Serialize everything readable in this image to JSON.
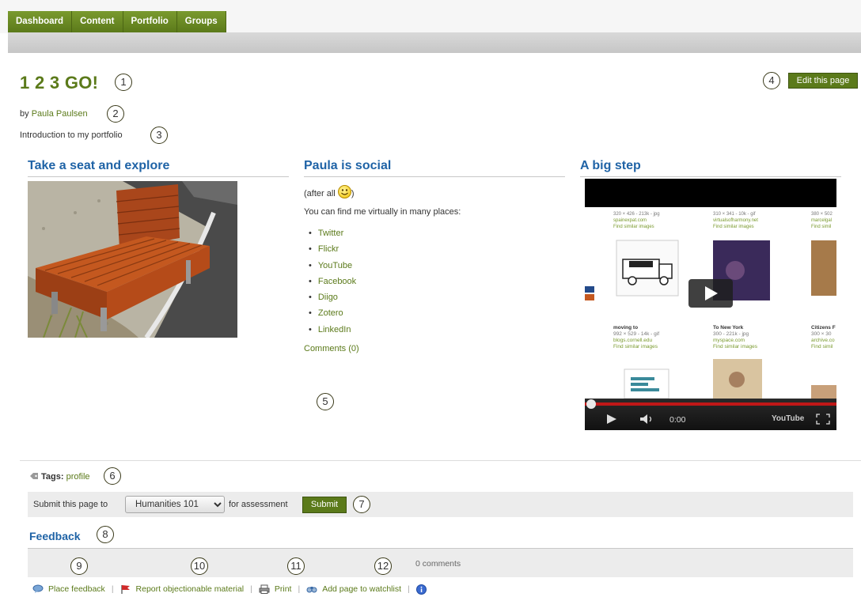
{
  "nav": {
    "tabs": [
      "Dashboard",
      "Content",
      "Portfolio",
      "Groups"
    ]
  },
  "page": {
    "title": "1 2 3 GO!",
    "by_prefix": "by",
    "author": "Paula Paulsen",
    "description": "Introduction to my portfolio",
    "edit_button": "Edit this page"
  },
  "callouts": [
    "1",
    "2",
    "3",
    "4",
    "5",
    "6",
    "7",
    "8",
    "9",
    "10",
    "11",
    "12"
  ],
  "columns": {
    "col1": {
      "heading": "Take a seat and explore"
    },
    "col2": {
      "heading": "Paula is social",
      "after_all": "(after all",
      "after_all_close": ")",
      "intro": "You can find me virtually in many places:",
      "links": [
        "Twitter",
        "Flickr",
        "YouTube",
        "Facebook",
        "Diigo",
        "Zotero",
        "LinkedIn"
      ],
      "comments": "Comments (0)"
    },
    "col3": {
      "heading": "A big step",
      "video_time": "0:00",
      "video_brand": "YouTube"
    }
  },
  "tags": {
    "label": "Tags:",
    "value": "profile"
  },
  "submit": {
    "prefix": "Submit this page to",
    "selected": "Humanities 101",
    "suffix": "for assessment",
    "button": "Submit"
  },
  "feedback": {
    "heading": "Feedback",
    "count": "0 comments",
    "actions": [
      "Place feedback",
      "Report objectionable material",
      "Print",
      "Add page to watchlist"
    ]
  },
  "icons": [
    "tag-icon",
    "feedback-icon",
    "flag-icon",
    "print-icon",
    "watchlist-icon",
    "info-icon",
    "smiley-icon",
    "play-icon"
  ],
  "colors": {
    "brand_green": "#5b7a1a",
    "heading_blue": "#1f63a6"
  }
}
